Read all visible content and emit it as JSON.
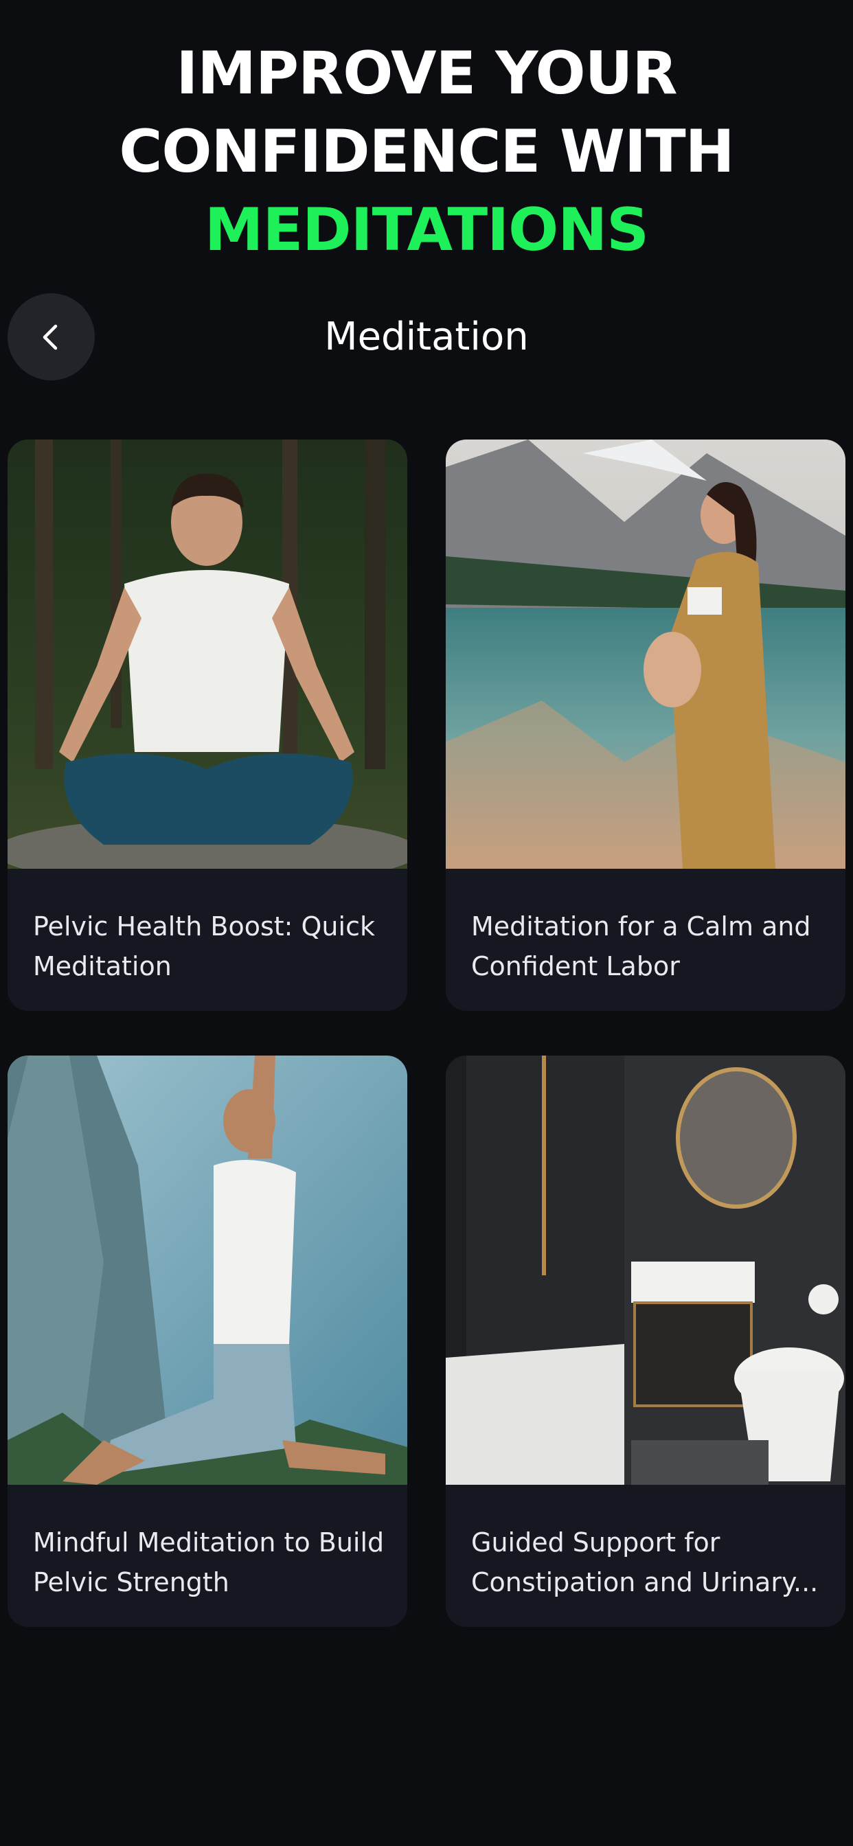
{
  "headline": {
    "line1": "IMPROVE YOUR",
    "line2": "CONFIDENCE WITH",
    "line3": "MEDITATIONS",
    "accent_color": "#1ef05a"
  },
  "nav": {
    "back_icon": "chevron-left-icon",
    "title": "Meditation"
  },
  "cards": [
    {
      "title": "Pelvic Health Boost: Quick Meditation",
      "image": "man-meditating-forest"
    },
    {
      "title": "Meditation for a Calm and Confident Labor",
      "image": "pregnant-woman-mountain-lake"
    },
    {
      "title": "Mindful Meditation to Build Pelvic Strength",
      "image": "man-yoga-pose-mountains"
    },
    {
      "title": "Guided Support for Constipation and Urinary...",
      "image": "dark-modern-bathroom"
    }
  ],
  "colors": {
    "background": "#0c0d11",
    "card": "#161821",
    "back_button": "#22242a"
  }
}
